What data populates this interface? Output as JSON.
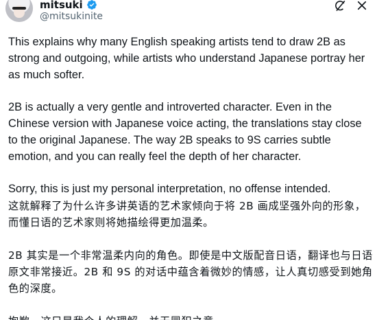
{
  "author": {
    "display_name": "mitsuki",
    "handle": "@mitsukinite",
    "verified_color": "#1d9bf0"
  },
  "actions": {
    "grok_icon": "grok-icon",
    "close_icon": "close-icon"
  },
  "post": {
    "en_p1": "This explains why many English speaking artists tend to draw 2B as strong and outgoing, while artists who understand Japanese portray her as much softer.",
    "en_p2": "2B is actually a very gentle and introverted character. Even in the Chinese version with Japanese voice acting, the translations stay close to the original Japanese. The way 2B speaks to 9S carries subtle emotion, and you can really feel the depth of her character.",
    "en_p3": "Sorry, this is just my personal interpretation, no offense intended.",
    "zh_p1": "这就解释了为什么许多讲英语的艺术家倾向于将 2B 画成坚强外向的形象，而懂日语的艺术家则将她描绘得更加温柔。",
    "zh_p2": "2B 其实是一个非常温柔内向的角色。即使是中文版配音日语，翻译也与日语原文非常接近。2B 和 9S 的对话中蕴含着微妙的情感，让人真切感受到她角色的深度。",
    "zh_p3": "抱歉，这只是我个人的理解，并无冒犯之意。"
  }
}
